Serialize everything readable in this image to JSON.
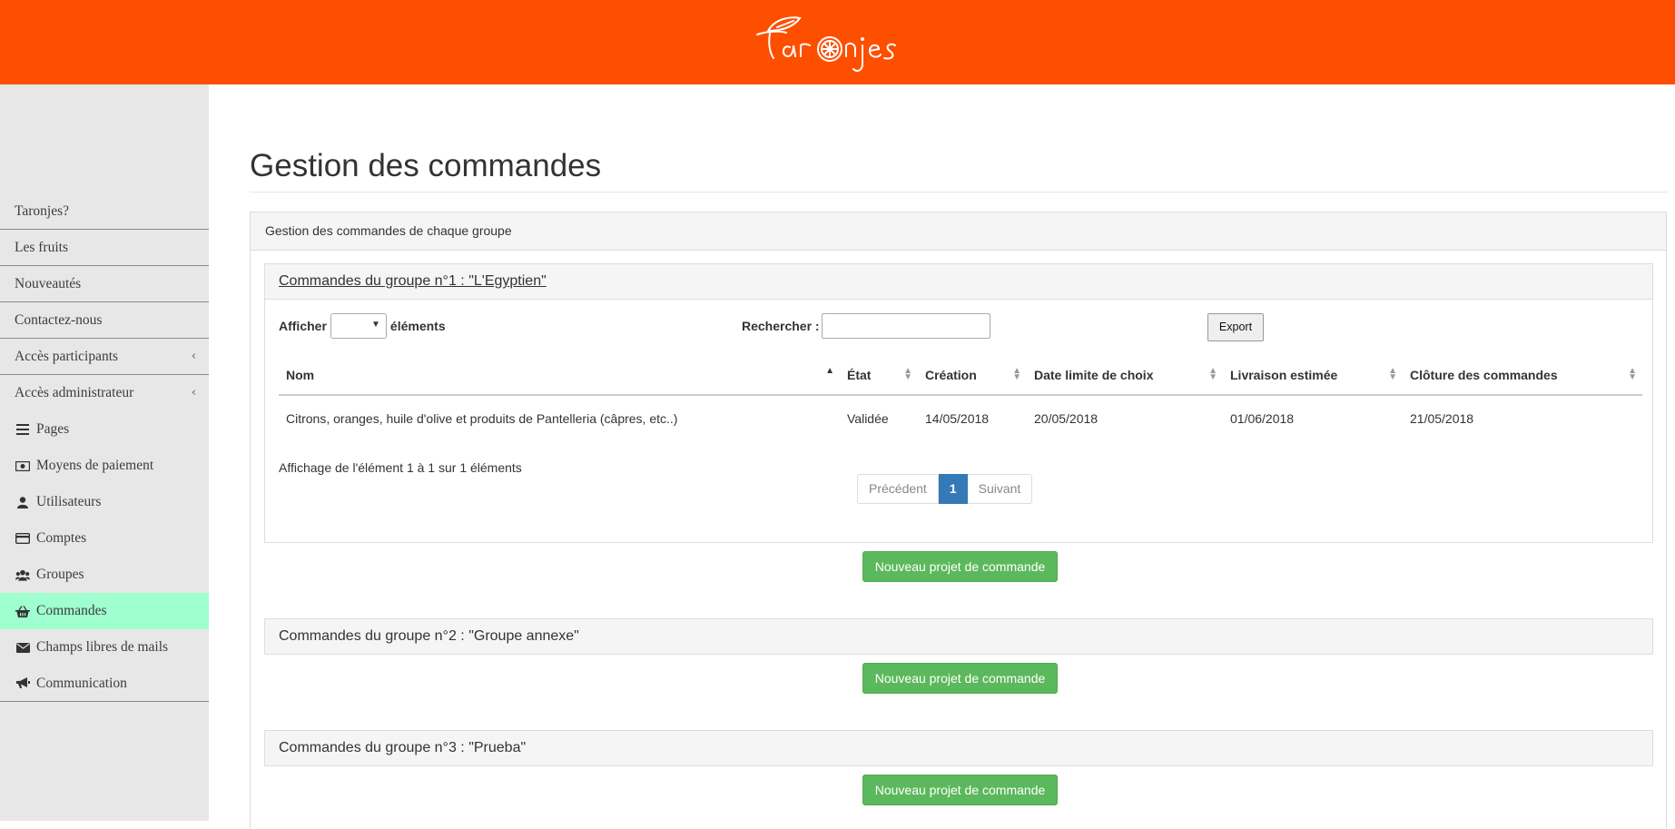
{
  "brand": {
    "logo_text": "Taronjes",
    "accent": "#fe4f00"
  },
  "sidebar": {
    "items": [
      {
        "label": "Taronjes?"
      },
      {
        "label": "Les fruits"
      },
      {
        "label": "Nouveautés"
      },
      {
        "label": "Contactez-nous"
      },
      {
        "label": "Accès participants",
        "chevron": "‹"
      },
      {
        "label": "Accès administrateur",
        "chevron": "‹"
      }
    ],
    "admin_items": [
      {
        "label": "Pages",
        "icon": "list-icon"
      },
      {
        "label": "Moyens de paiement",
        "icon": "money-icon"
      },
      {
        "label": "Utilisateurs",
        "icon": "user-icon"
      },
      {
        "label": "Comptes",
        "icon": "credit-card-icon"
      },
      {
        "label": "Groupes",
        "icon": "users-icon"
      },
      {
        "label": "Commandes",
        "icon": "basket-icon",
        "active": true
      },
      {
        "label": "Champs libres de mails",
        "icon": "envelope-icon"
      },
      {
        "label": "Communication",
        "icon": "bullhorn-icon"
      }
    ],
    "active_color": "#9fffcf"
  },
  "main": {
    "title": "Gestion des commandes",
    "panel_title": "Gestion des commandes de chaque groupe",
    "groups": [
      {
        "title": "Commandes du groupe n°1 : \"L'Egyptien\"",
        "afficher": "Afficher",
        "elements": "éléments",
        "search_label": "Rechercher :",
        "export": "Export",
        "columns": [
          "Nom",
          "État",
          "Création",
          "Date limite de choix",
          "Livraison estimée",
          "Clôture des commandes"
        ],
        "rows": [
          [
            "Citrons, oranges, huile d'olive et produits de Pantelleria (câpres, etc..)",
            "Validée",
            "14/05/2018",
            "20/05/2018",
            "01/06/2018",
            "21/05/2018"
          ]
        ],
        "info": "Affichage de l'élément 1 à 1 sur 1 éléments",
        "pager": {
          "prev": "Précédent",
          "current": "1",
          "next": "Suivant"
        },
        "button": "Nouveau projet de commande"
      },
      {
        "title": "Commandes du groupe n°2 : \"Groupe annexe\"",
        "button": "Nouveau projet de commande"
      },
      {
        "title": "Commandes du groupe n°3 : \"Prueba\"",
        "button": "Nouveau projet de commande"
      }
    ]
  }
}
